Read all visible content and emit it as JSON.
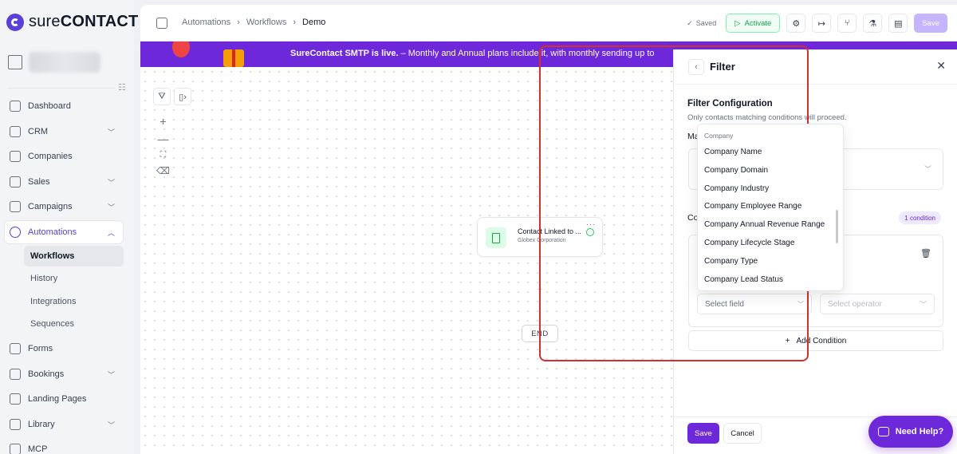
{
  "brand": {
    "logo_light": "sure",
    "logo_bold": "CONTACT"
  },
  "sidebar": {
    "items": [
      {
        "label": "Dashboard",
        "icon": "dashboard-icon"
      },
      {
        "label": "CRM",
        "icon": "crm-icon"
      },
      {
        "label": "Companies",
        "icon": "building-icon"
      },
      {
        "label": "Sales",
        "icon": "briefcase-icon"
      },
      {
        "label": "Campaigns",
        "icon": "megaphone-icon"
      },
      {
        "label": "Automations",
        "icon": "automation-icon"
      },
      {
        "label": "Forms",
        "icon": "form-icon"
      },
      {
        "label": "Bookings",
        "icon": "calendar-icon"
      },
      {
        "label": "Landing Pages",
        "icon": "layout-icon"
      },
      {
        "label": "Library",
        "icon": "library-icon"
      },
      {
        "label": "MCP",
        "icon": "mcp-icon"
      }
    ],
    "automation_sub": [
      "Workflows",
      "History",
      "Integrations",
      "Sequences"
    ]
  },
  "header": {
    "breadcrumb": [
      "Automations",
      "Workflows",
      "Demo"
    ],
    "saved_label": "Saved",
    "activate_label": "Activate",
    "save_label": "Save"
  },
  "banner": {
    "bold": "SureContact SMTP is live.",
    "text": " – Monthly and Annual plans include it, with monthly sending up to"
  },
  "canvas": {
    "node_title": "Contact Linked to ...",
    "node_subtitle": "Globex Corporation",
    "end_label": "END"
  },
  "filter": {
    "title": "Filter",
    "config_title": "Filter Configuration",
    "config_subtitle": "Only contacts matching conditions will proceed.",
    "match_label_visible": "Ma",
    "conditions_label_visible": "Co",
    "condition_count": "1 condition",
    "select_field_placeholder": "Select field",
    "select_operator_placeholder": "Select operator",
    "add_condition": "Add Condition",
    "save": "Save",
    "cancel": "Cancel"
  },
  "dropdown": {
    "group": "Company",
    "options": [
      "Company Name",
      "Company Domain",
      "Company Industry",
      "Company Employee Range",
      "Company Annual Revenue Range",
      "Company Lifecycle Stage",
      "Company Type",
      "Company Lead Status"
    ]
  },
  "help": {
    "label": "Need Help?"
  },
  "colors": {
    "accent": "#6d28d9",
    "highlight": "#d32f2f",
    "success": "#16a34a"
  }
}
